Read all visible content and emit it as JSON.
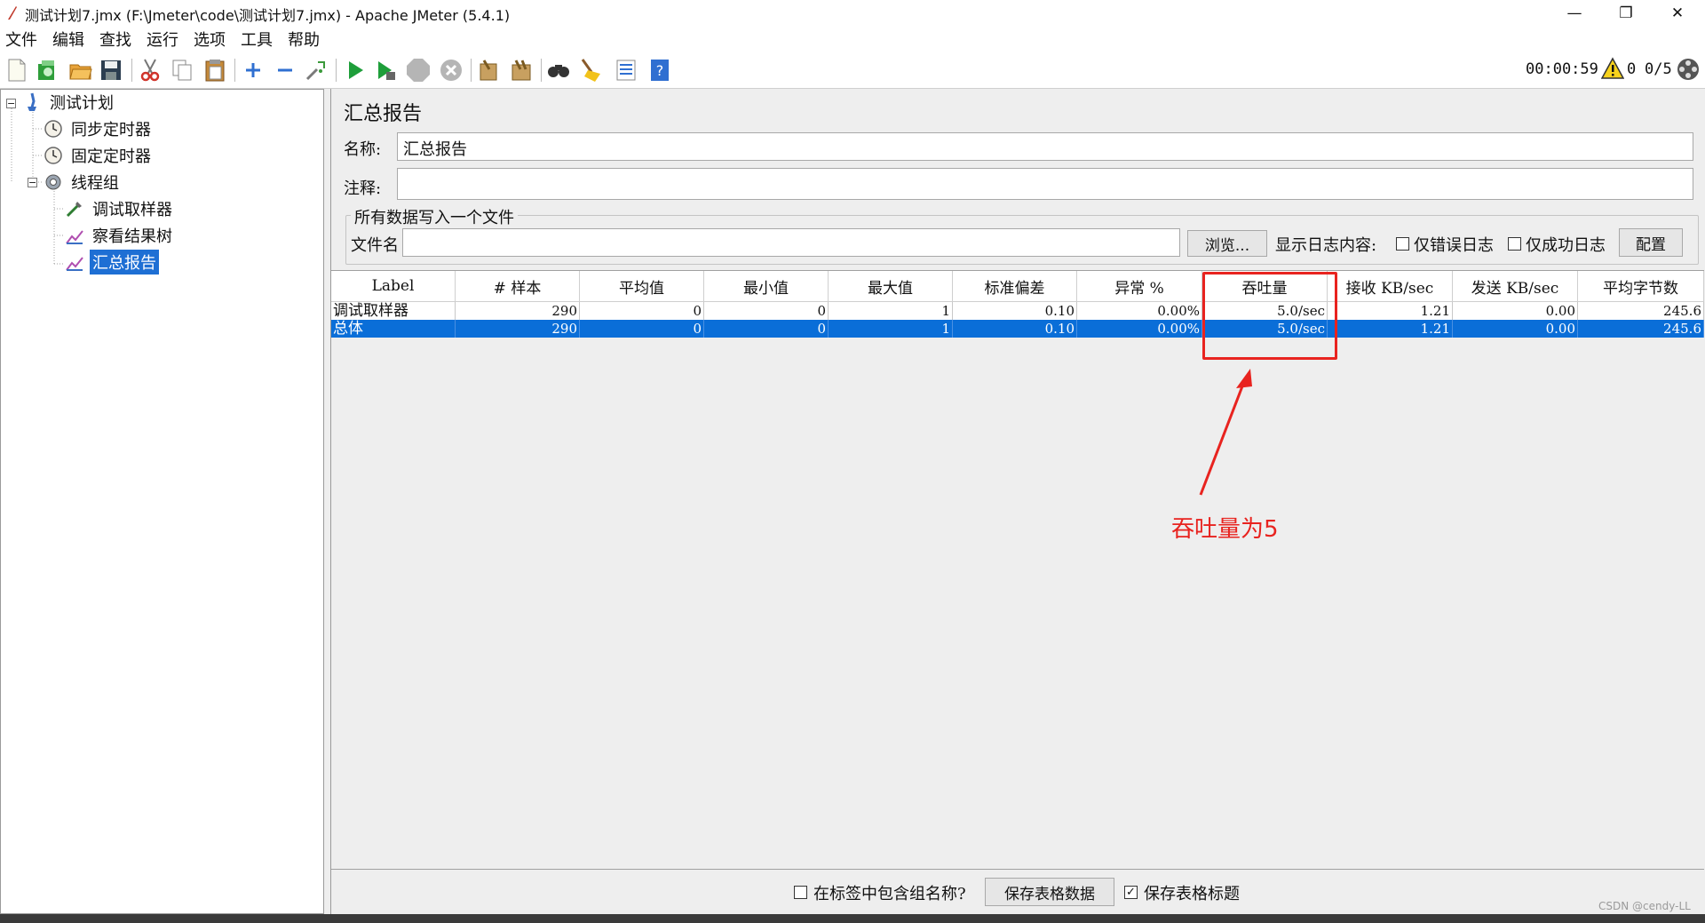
{
  "window": {
    "title": "测试计划7.jmx (F:\\Jmeter\\code\\测试计划7.jmx) - Apache JMeter (5.4.1)",
    "minimize": "—",
    "restore": "❐",
    "close": "✕"
  },
  "menu": [
    "文件",
    "编辑",
    "查找",
    "运行",
    "选项",
    "工具",
    "帮助"
  ],
  "toolbar": {
    "icons": [
      "new-icon",
      "templates-icon",
      "open-icon",
      "save-icon",
      "cut-icon",
      "copy-icon",
      "paste-icon",
      "expand-icon",
      "collapse-icon",
      "toggle-icon",
      "start-icon",
      "start-no-pause-icon",
      "stop-icon",
      "shutdown-icon",
      "clear-icon",
      "clear-all-icon",
      "search-icon",
      "reset-search-icon",
      "function-helper-icon",
      "help-icon"
    ],
    "timer": "00:00:59",
    "warning_count": "0",
    "thread_ratio": "0/5"
  },
  "tree": {
    "items": [
      {
        "label": "测试计划",
        "icon": "test-plan-icon"
      },
      {
        "label": "同步定时器",
        "icon": "timer-icon"
      },
      {
        "label": "固定定时器",
        "icon": "timer-icon"
      },
      {
        "label": "线程组",
        "icon": "gear-icon"
      },
      {
        "label": "调试取样器",
        "icon": "sampler-icon"
      },
      {
        "label": "察看结果树",
        "icon": "listener-icon"
      },
      {
        "label": "汇总报告",
        "icon": "listener-icon",
        "selected": true
      }
    ]
  },
  "panel": {
    "title": "汇总报告",
    "name_label": "名称:",
    "name_value": "汇总报告",
    "comment_label": "注释:",
    "comment_value": "",
    "fileset_legend": "所有数据写入一个文件",
    "filename_label": "文件名",
    "filename_value": "",
    "browse_button": "浏览...",
    "log_display_label": "显示日志内容:",
    "errors_only_label": "仅错误日志",
    "successes_only_label": "仅成功日志",
    "configure_button": "配置"
  },
  "table": {
    "columns": [
      "Label",
      "# 样本",
      "平均值",
      "最小值",
      "最大值",
      "标准偏差",
      "异常 %",
      "吞吐量",
      "接收 KB/sec",
      "发送 KB/sec",
      "平均字节数"
    ],
    "rows": [
      {
        "cells": [
          "调试取样器",
          "290",
          "0",
          "0",
          "1",
          "0.10",
          "0.00%",
          "5.0/sec",
          "1.21",
          "0.00",
          "245.6"
        ],
        "selected": false
      },
      {
        "cells": [
          "总体",
          "290",
          "0",
          "0",
          "1",
          "0.10",
          "0.00%",
          "5.0/sec",
          "1.21",
          "0.00",
          "245.6"
        ],
        "selected": true
      }
    ]
  },
  "bottom": {
    "include_group_label": "在标签中包含组名称?",
    "include_group_checked": false,
    "save_table_button": "保存表格数据",
    "save_header_label": "保存表格标题",
    "save_header_checked": true
  },
  "annotation": {
    "text": "吞吐量为5",
    "color": "#e8231f"
  },
  "watermark": "CSDN @cendy-LL",
  "colors": {
    "selection": "#0a6ed8",
    "annotation": "#e8231f"
  }
}
